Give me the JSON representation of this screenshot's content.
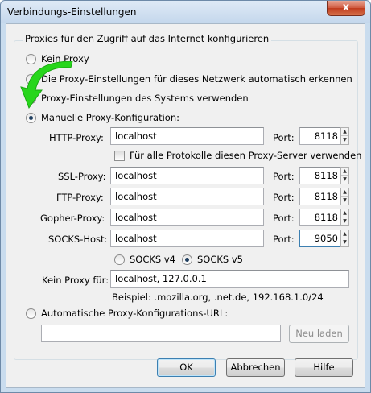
{
  "window": {
    "title": "Verbindungs-Einstellungen",
    "close_glyph": "x"
  },
  "group": {
    "legend": "Proxies für den Zugriff auf das Internet konfigurieren"
  },
  "options": {
    "no_proxy": "Kein Proxy",
    "auto_detect": "Die Proxy-Einstellungen für dieses Netzwerk automatisch erkennen",
    "system": "Proxy-Einstellungen des Systems verwenden",
    "manual": "Manuelle Proxy-Konfiguration:",
    "auto_url": "Automatische Proxy-Konfigurations-URL:"
  },
  "proxies": [
    {
      "label": "HTTP-Proxy:",
      "host": "localhost",
      "port_label": "Port:",
      "port": "8118"
    },
    {
      "label": "SSL-Proxy:",
      "host": "localhost",
      "port_label": "Port:",
      "port": "8118"
    },
    {
      "label": "FTP-Proxy:",
      "host": "localhost",
      "port_label": "Port:",
      "port": "8118"
    },
    {
      "label": "Gopher-Proxy:",
      "host": "localhost",
      "port_label": "Port:",
      "port": "8118"
    },
    {
      "label": "SOCKS-Host:",
      "host": "localhost",
      "port_label": "Port:",
      "port": "9050"
    }
  ],
  "all_protocols": "Für alle Protokolle diesen Proxy-Server verwenden",
  "socks": {
    "v4": "SOCKS v4",
    "v5": "SOCKS v5",
    "selected": "v5"
  },
  "no_proxy_for": {
    "label": "Kein Proxy für:",
    "value": "localhost, 127.0.0.1",
    "example": "Beispiel: .mozilla.org, .net.de, 192.168.1.0/24"
  },
  "auto_url_field": {
    "value": ""
  },
  "buttons": {
    "reload": "Neu laden",
    "ok": "OK",
    "cancel": "Abbrechen",
    "help": "Hilfe"
  },
  "selected_option": "manual",
  "colors": {
    "annotation_arrow": "#27d61b",
    "accent": "#3c7fb1"
  }
}
